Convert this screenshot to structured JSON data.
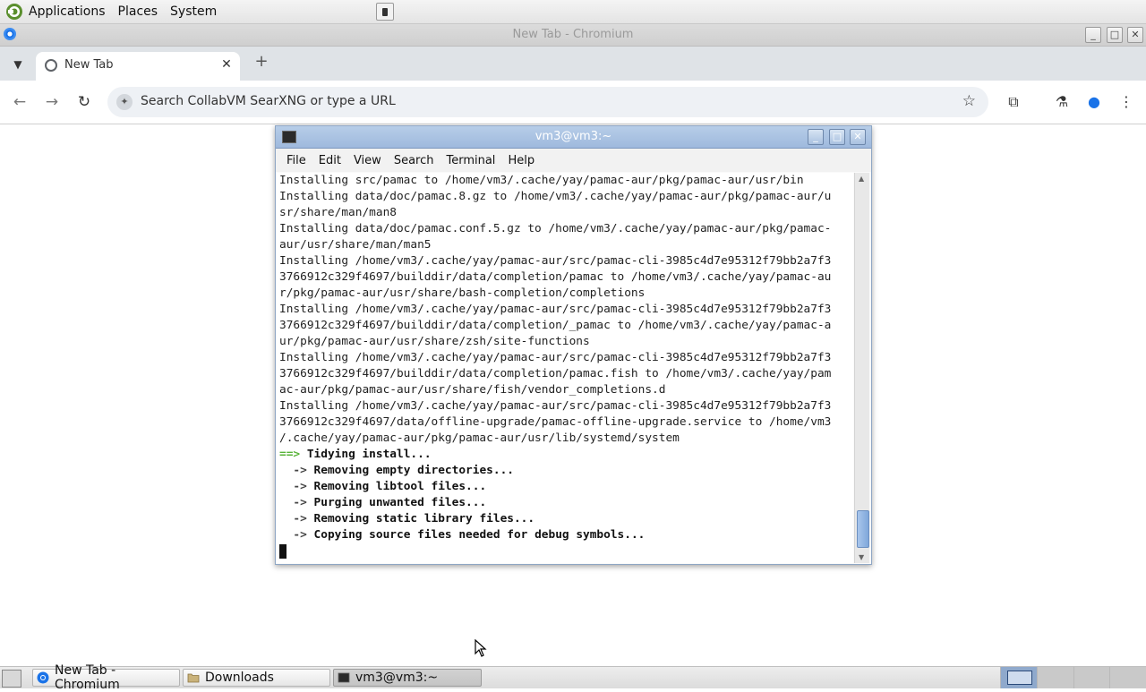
{
  "top_panel": {
    "menus": [
      "Applications",
      "Places",
      "System"
    ]
  },
  "chromium": {
    "window_title": "New Tab - Chromium",
    "tab": {
      "title": "New Tab",
      "close": "✕"
    },
    "new_tab": "+",
    "omnibox_placeholder": "Search CollabVM SearXNG or type a URL",
    "icons": [
      "tab-search-icon",
      "back-icon",
      "forward-icon",
      "reload-icon",
      "lens-icon",
      "bookmark-star-icon",
      "extensions-icon",
      "labs-flask-icon",
      "profile-icon",
      "menu-dots-icon"
    ]
  },
  "terminal": {
    "title": "vm3@vm3:~",
    "menus": [
      "File",
      "Edit",
      "View",
      "Search",
      "Terminal",
      "Help"
    ],
    "lines": [
      "Installing src/pamac to /home/vm3/.cache/yay/pamac-aur/pkg/pamac-aur/usr/bin",
      "Installing data/doc/pamac.8.gz to /home/vm3/.cache/yay/pamac-aur/pkg/pamac-aur/u",
      "sr/share/man/man8",
      "Installing data/doc/pamac.conf.5.gz to /home/vm3/.cache/yay/pamac-aur/pkg/pamac-",
      "aur/usr/share/man/man5",
      "Installing /home/vm3/.cache/yay/pamac-aur/src/pamac-cli-3985c4d7e95312f79bb2a7f3",
      "3766912c329f4697/builddir/data/completion/pamac to /home/vm3/.cache/yay/pamac-au",
      "r/pkg/pamac-aur/usr/share/bash-completion/completions",
      "Installing /home/vm3/.cache/yay/pamac-aur/src/pamac-cli-3985c4d7e95312f79bb2a7f3",
      "3766912c329f4697/builddir/data/completion/_pamac to /home/vm3/.cache/yay/pamac-a",
      "ur/pkg/pamac-aur/usr/share/zsh/site-functions",
      "Installing /home/vm3/.cache/yay/pamac-aur/src/pamac-cli-3985c4d7e95312f79bb2a7f3",
      "3766912c329f4697/builddir/data/completion/pamac.fish to /home/vm3/.cache/yay/pam",
      "ac-aur/pkg/pamac-aur/usr/share/fish/vendor_completions.d",
      "Installing /home/vm3/.cache/yay/pamac-aur/src/pamac-cli-3985c4d7e95312f79bb2a7f3",
      "3766912c329f4697/data/offline-upgrade/pamac-offline-upgrade.service to /home/vm3",
      "/.cache/yay/pamac-aur/pkg/pamac-aur/usr/lib/systemd/system"
    ],
    "status_header": {
      "arrow": "==>",
      "text": "Tidying install..."
    },
    "status_steps": [
      {
        "arrow": "  ->",
        "text": "Removing empty directories..."
      },
      {
        "arrow": "  ->",
        "text": "Removing libtool files..."
      },
      {
        "arrow": "  ->",
        "text": "Purging unwanted files..."
      },
      {
        "arrow": "  ->",
        "text": "Removing static library files..."
      },
      {
        "arrow": "  ->",
        "text": "Copying source files needed for debug symbols..."
      }
    ],
    "colors": {
      "arrow_header": "#58b338",
      "titlebar": "#a8c1e2"
    }
  },
  "taskbar": {
    "tasks": [
      {
        "label": "New Tab - Chromium",
        "icon": "chromium-icon"
      },
      {
        "label": "Downloads",
        "icon": "folder-icon"
      },
      {
        "label": "vm3@vm3:~",
        "icon": "terminal-icon"
      }
    ]
  }
}
